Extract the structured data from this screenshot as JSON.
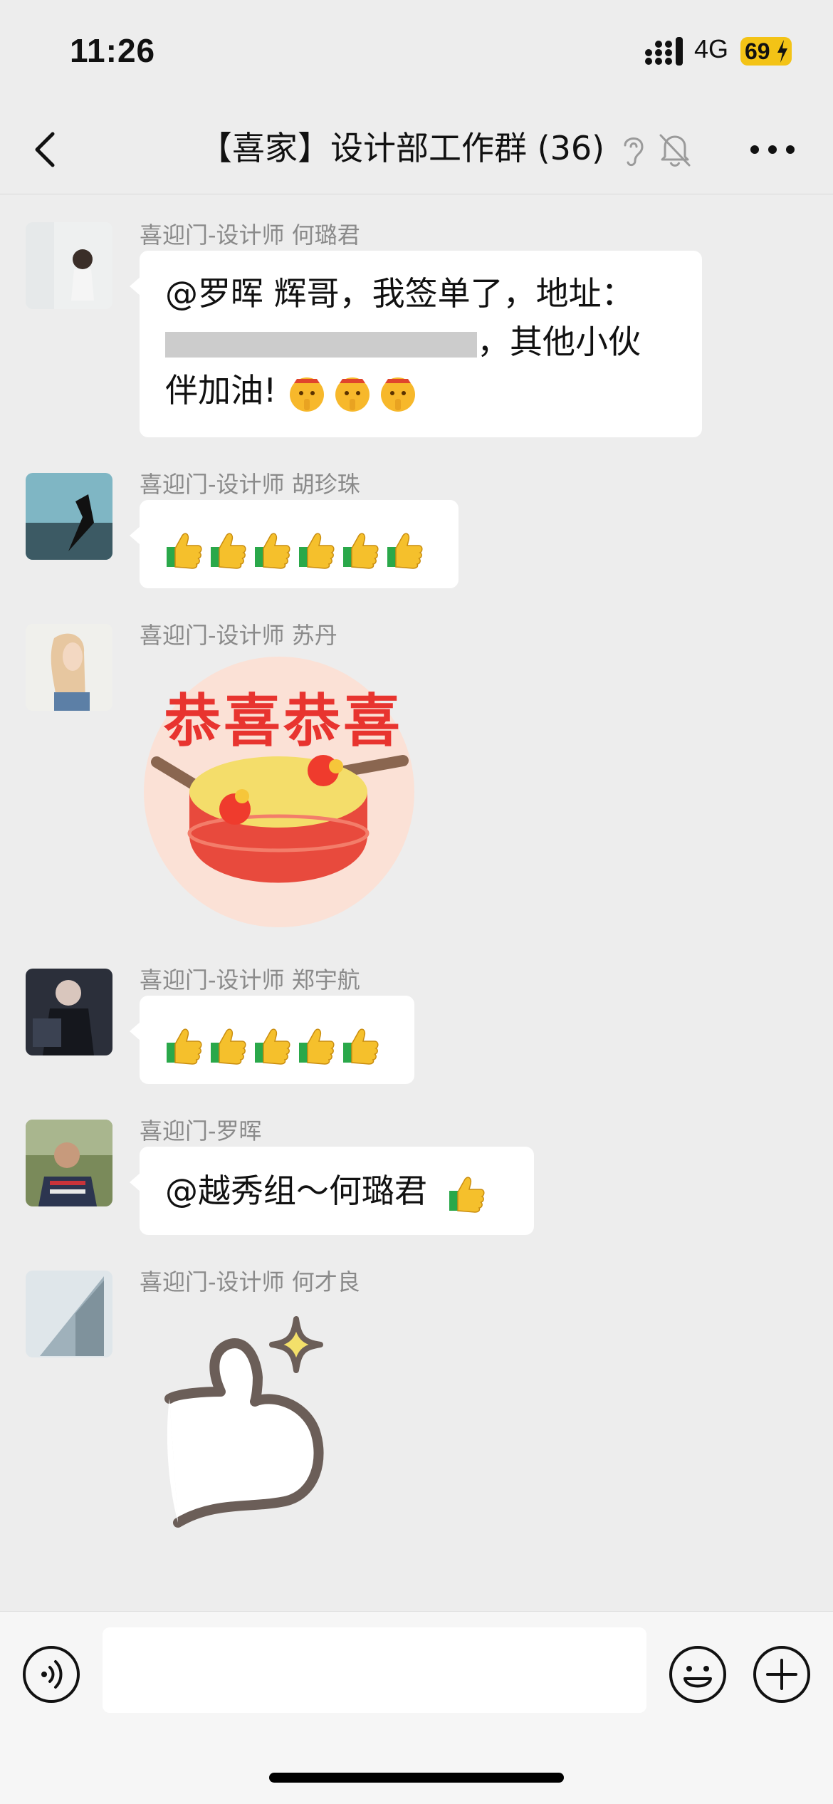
{
  "status_bar": {
    "time": "11:26",
    "network": "4G",
    "battery": "69"
  },
  "header": {
    "back_icon": "chevron-left-icon",
    "title": "【喜家】设计部工作群 (36)",
    "icons": [
      "ear-icon",
      "bell-off-icon",
      "more-icon"
    ]
  },
  "messages": [
    {
      "sender": "喜迎门-设计师 何璐君",
      "text_line1": "@罗晖 辉哥，我签单了，地址：",
      "text_line2_tail": "，其他小伙",
      "text_line3": "伴加油!",
      "emoji": "shushing-face-emoji",
      "emoji_count": 3
    },
    {
      "sender": "喜迎门-设计师 胡珍珠",
      "emoji": "thumbs-up-emoji",
      "emoji_count": 6
    },
    {
      "sender": "喜迎门-设计师 苏丹",
      "sticker_text": "恭喜恭喜",
      "sticker": "drum-sticker"
    },
    {
      "sender": "喜迎门-设计师 郑宇航",
      "emoji": "thumbs-up-emoji",
      "emoji_count": 5
    },
    {
      "sender": "喜迎门-罗晖",
      "text": "@越秀组～何璐君",
      "emoji": "thumbs-up-emoji"
    },
    {
      "sender": "喜迎门-设计师 何才良",
      "sticker": "thumbs-up-sparkle-sticker"
    }
  ],
  "input_bar": {
    "icons": [
      "voice-icon",
      "emoji-icon",
      "plus-icon"
    ],
    "input_value": ""
  },
  "colors": {
    "background": "#ededed",
    "bubble": "#ffffff",
    "sender": "#8a8a8a",
    "battery": "#f3c316",
    "sticker_red": "#e8342f"
  }
}
